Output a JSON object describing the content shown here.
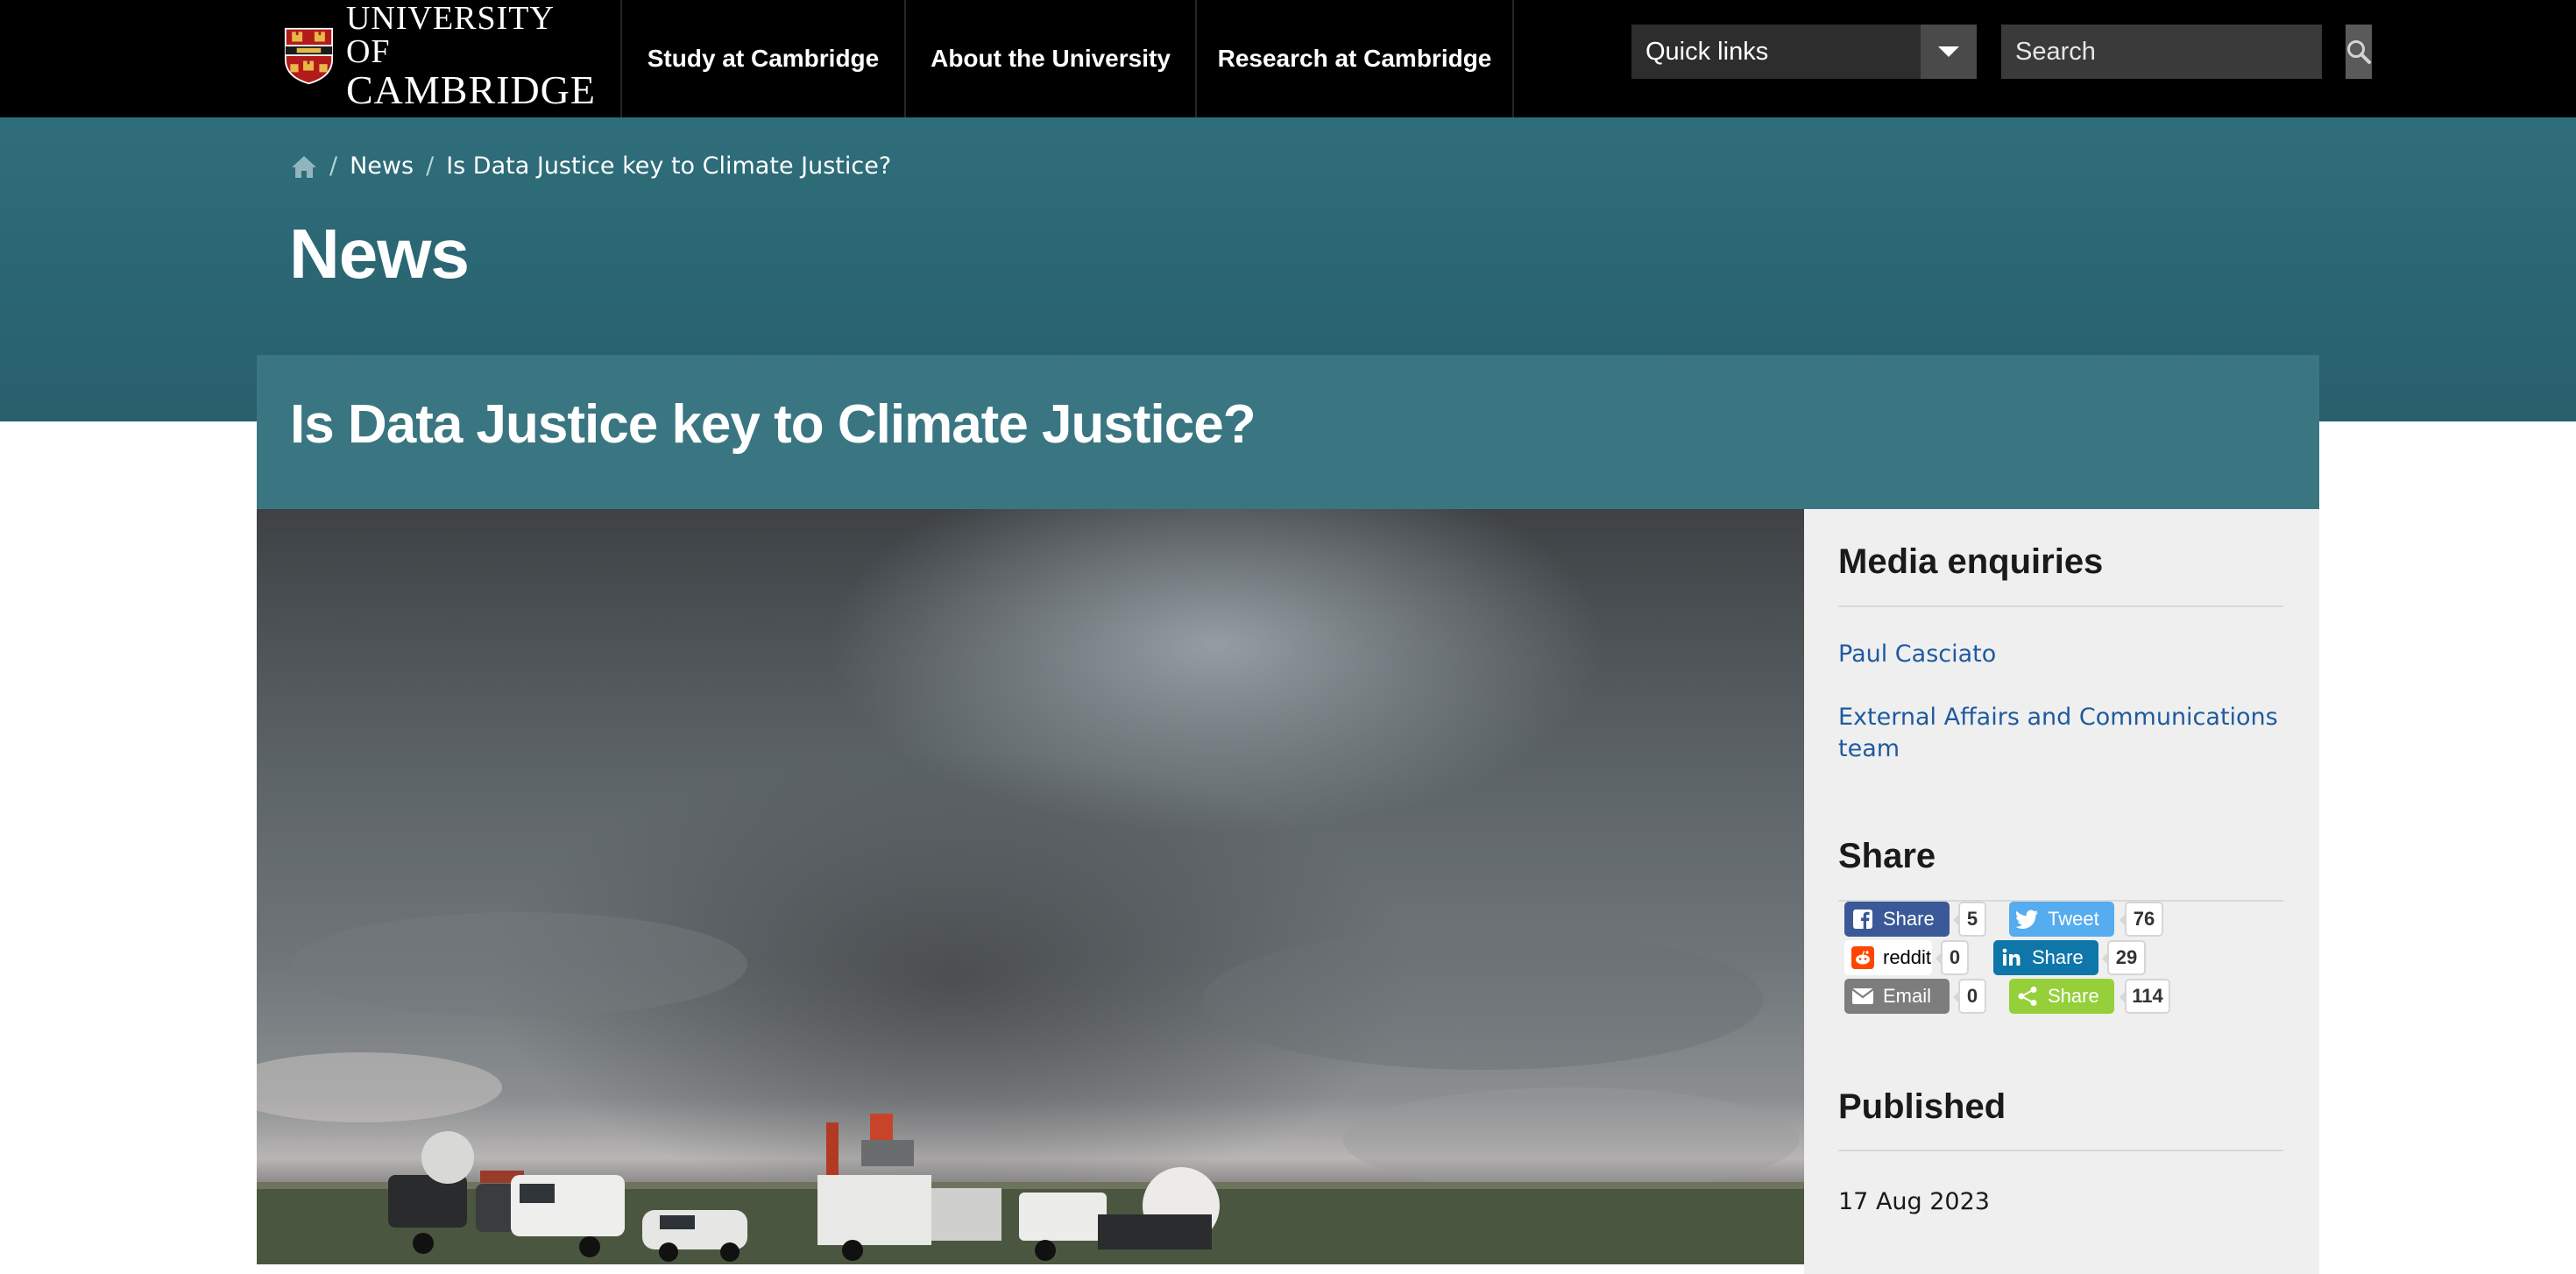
{
  "header": {
    "logo_line1": "UNIVERSITY OF",
    "logo_line2": "CAMBRIDGE",
    "nav": [
      {
        "label": "Study at Cambridge"
      },
      {
        "label": "About the University"
      },
      {
        "label": "Research at Cambridge"
      }
    ],
    "quick_links_label": "Quick links",
    "search_placeholder": "Search"
  },
  "breadcrumb": {
    "items": [
      "News",
      "Is Data Justice key to Climate Justice?"
    ]
  },
  "page_title": "News",
  "article": {
    "title": "Is Data Justice key to Climate Justice?"
  },
  "sidebar": {
    "media_heading": "Media enquiries",
    "contacts": [
      {
        "label": "Paul Casciato"
      },
      {
        "label": "External Affairs and Communications team"
      }
    ],
    "share_heading": "Share",
    "share_buttons": [
      {
        "label": "Share",
        "count": "5",
        "service": "facebook",
        "color": "#3b5998"
      },
      {
        "label": "Tweet",
        "count": "76",
        "service": "twitter",
        "color": "#55acee"
      },
      {
        "label": "reddit",
        "count": "0",
        "service": "reddit",
        "color": "#ffffff"
      },
      {
        "label": "Share",
        "count": "29",
        "service": "linkedin",
        "color": "#0e76a8"
      },
      {
        "label": "Email",
        "count": "0",
        "service": "email",
        "color": "#7d7d7d"
      },
      {
        "label": "Share",
        "count": "114",
        "service": "sharethis",
        "color": "#95d03a"
      }
    ],
    "published_heading": "Published",
    "published_date": "17 Aug 2023"
  },
  "colors": {
    "topbar": "#000000",
    "hero_teal": "#2e6e7a",
    "article_panel": "#3a7682",
    "sidebar_bg": "#efefef",
    "link": "#1e5a9e"
  },
  "icons": {
    "home": "home-icon",
    "search": "search-icon",
    "dropdown": "chevron-down-icon"
  }
}
